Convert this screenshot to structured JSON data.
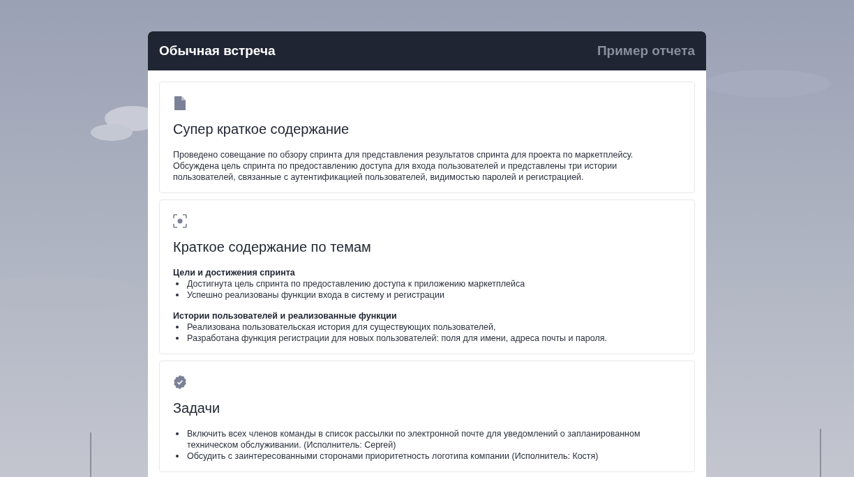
{
  "header": {
    "title": "Обычная встреча",
    "subtitle": "Пример отчета"
  },
  "sections": [
    {
      "title": "Супер краткое содержание",
      "kind": "paragraph",
      "text": "Проведено совещание по обзору спринта для представления результатов спринта для проекта по маркетплейсу. Обсуждена цель спринта по предоставлению доступа для входа пользователей и представлены три истории пользователей, связанные с аутентификацией пользователей, видимостью паролей и регистрацией."
    },
    {
      "title": "Краткое содержание по темам",
      "kind": "topics",
      "topics": [
        {
          "heading": "Цели и достижения спринта",
          "items": [
            "Достигнута цель спринта по предоставлению доступа к приложению маркетплейса",
            "Успешно реализованы функции входа в систему и регистрации"
          ]
        },
        {
          "heading": "Истории пользователей и реализованные функции",
          "items": [
            "Реализована пользовательская история для существующих пользователей,",
            "Разработана функция регистрации для новых пользователей: поля для имени, адреса почты и пароля."
          ]
        }
      ]
    },
    {
      "title": "Задачи",
      "kind": "list",
      "items": [
        "Включить всех членов команды в список рассылки по электронной почте для уведомлений о запланированном техническом обслуживании. (Исполнитель: Сергей)",
        "Обсудить с заинтересованными сторонами приоритетность логотипа компании (Исполнитель: Костя)"
      ]
    }
  ]
}
